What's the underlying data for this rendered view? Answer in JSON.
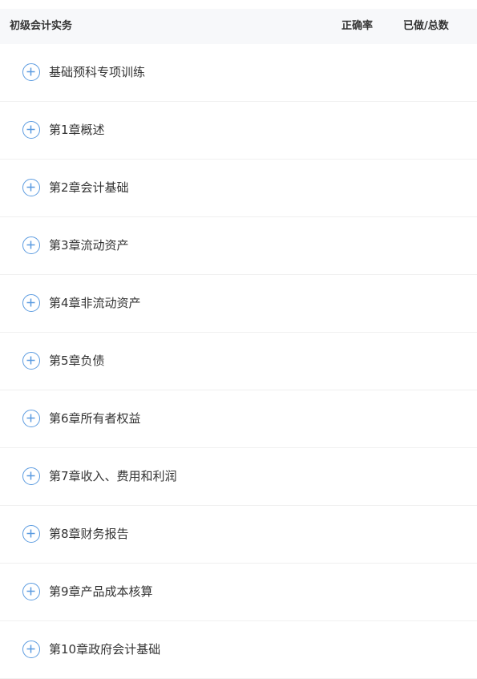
{
  "header": {
    "title": "初级会计实务",
    "accuracy_label": "正确率",
    "progress_label": "已做/总数"
  },
  "accent_color": "#5b9be0",
  "chapters": [
    {
      "label": "基础预科专项训练",
      "icon": "plus-circle-icon"
    },
    {
      "label": "第1章概述",
      "icon": "plus-circle-icon"
    },
    {
      "label": "第2章会计基础",
      "icon": "plus-circle-icon"
    },
    {
      "label": "第3章流动资产",
      "icon": "plus-circle-icon"
    },
    {
      "label": "第4章非流动资产",
      "icon": "plus-circle-icon"
    },
    {
      "label": "第5章负债",
      "icon": "plus-circle-icon"
    },
    {
      "label": "第6章所有者权益",
      "icon": "plus-circle-icon"
    },
    {
      "label": "第7章收入、费用和利润",
      "icon": "plus-circle-icon"
    },
    {
      "label": "第8章财务报告",
      "icon": "plus-circle-icon"
    },
    {
      "label": "第9章产品成本核算",
      "icon": "plus-circle-icon"
    },
    {
      "label": "第10章政府会计基础",
      "icon": "plus-circle-icon"
    }
  ]
}
